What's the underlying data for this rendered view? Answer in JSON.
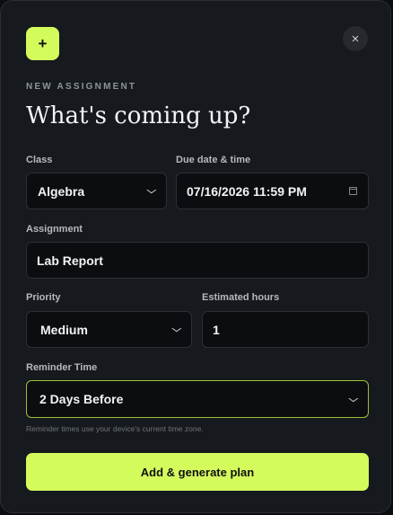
{
  "header": {
    "plus_glyph": "+",
    "close_glyph": "×",
    "eyebrow": "NEW ASSIGNMENT",
    "title": "What's coming up?"
  },
  "form": {
    "class": {
      "label": "Class",
      "value": "Algebra",
      "icon": "chevron-down-icon"
    },
    "due": {
      "label": "Due date & time",
      "value": "07/16/2026 11:59 PM",
      "icon": "calendar-icon"
    },
    "assignment": {
      "label": "Assignment",
      "value": "Lab Report"
    },
    "priority": {
      "label": "Priority",
      "value": "Medium",
      "icon": "chevron-down-icon"
    },
    "hours": {
      "label": "Estimated hours",
      "value": "1"
    },
    "reminder": {
      "label": "Reminder Time",
      "value": "2 Days Before",
      "icon": "chevron-down-icon"
    },
    "hint": "Reminder times use your device's current time zone."
  },
  "actions": {
    "submit_label": "Add & generate plan"
  },
  "colors": {
    "accent": "#d4fb5c",
    "background": "#16191d",
    "field_bg": "#0b0d10"
  }
}
